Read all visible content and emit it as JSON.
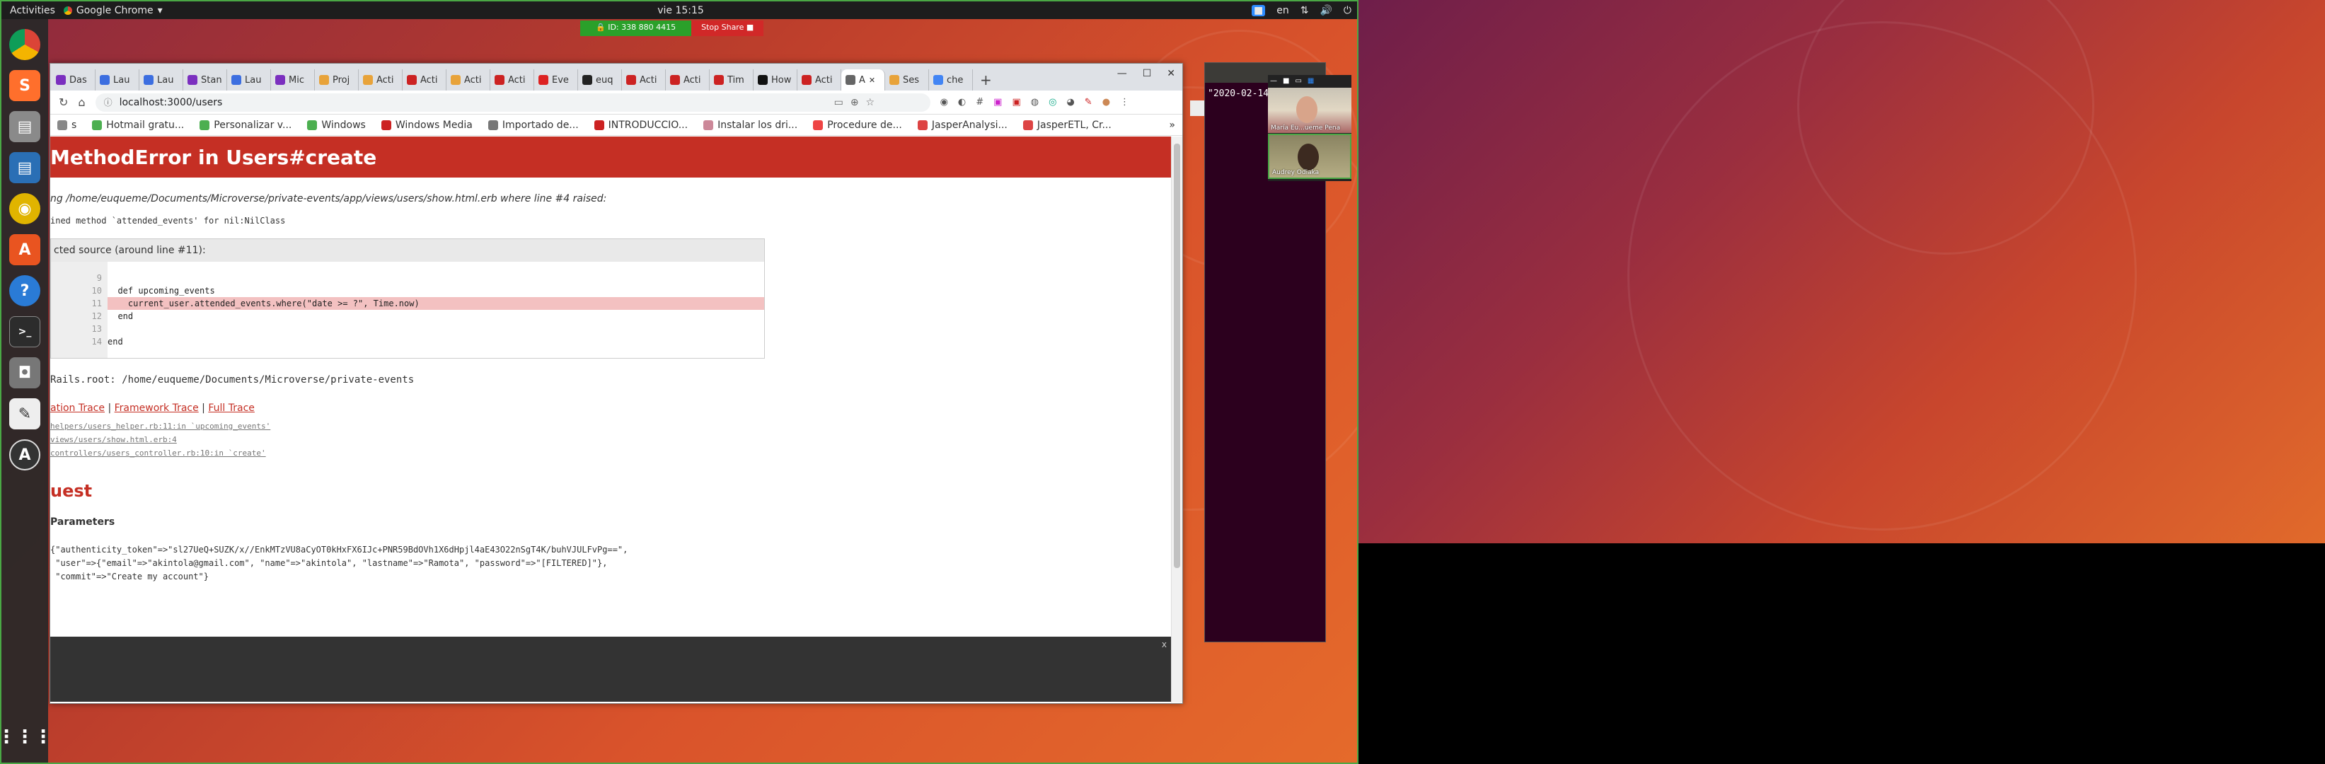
{
  "topbar": {
    "activities": "Activities",
    "app_name": "Google Chrome",
    "clock": "vie 15:15",
    "lang": "en"
  },
  "share": {
    "id_label": "ID: 338 880 4415",
    "stop_label": "Stop Share"
  },
  "browser": {
    "tabs": [
      {
        "label": "Das",
        "color": "#7b2fbf"
      },
      {
        "label": "Lau",
        "color": "#3c6ee0"
      },
      {
        "label": "Lau",
        "color": "#3c6ee0"
      },
      {
        "label": "Stan",
        "color": "#7b2fbf"
      },
      {
        "label": "Lau",
        "color": "#3c6ee0"
      },
      {
        "label": "Mic",
        "color": "#7b2fbf"
      },
      {
        "label": "Proj",
        "color": "#e8a33a"
      },
      {
        "label": "Acti",
        "color": "#e8a33a"
      },
      {
        "label": "Acti",
        "color": "#c22"
      },
      {
        "label": "Acti",
        "color": "#e8a33a"
      },
      {
        "label": "Acti",
        "color": "#c22"
      },
      {
        "label": "Eve",
        "color": "#d22"
      },
      {
        "label": "euq",
        "color": "#222"
      },
      {
        "label": "Acti",
        "color": "#c22"
      },
      {
        "label": "Acti",
        "color": "#c22"
      },
      {
        "label": "Tim",
        "color": "#c22"
      },
      {
        "label": "How",
        "color": "#111"
      },
      {
        "label": "Acti",
        "color": "#c22"
      },
      {
        "label": "A",
        "color": "#666"
      },
      {
        "label": "Ses",
        "color": "#e8a33a"
      },
      {
        "label": "che",
        "color": "#4285f4"
      }
    ],
    "url": "localhost:3000/users",
    "bookmarks": [
      {
        "label": "s",
        "color": "#888"
      },
      {
        "label": "Hotmail gratu...",
        "color": "#4caf50"
      },
      {
        "label": "Personalizar v...",
        "color": "#4caf50"
      },
      {
        "label": "Windows",
        "color": "#4caf50"
      },
      {
        "label": "Windows Media",
        "color": "#c22"
      },
      {
        "label": "Importado de...",
        "color": "#777"
      },
      {
        "label": "INTRODUCCIO...",
        "color": "#c22"
      },
      {
        "label": "Instalar los dri...",
        "color": "#c89"
      },
      {
        "label": "Procedure de...",
        "color": "#e44"
      },
      {
        "label": "JasperAnalysi...",
        "color": "#d44"
      },
      {
        "label": "JasperETL, Cr...",
        "color": "#d44"
      }
    ]
  },
  "error_page": {
    "title": "MethodError in Users#create",
    "raised_text": "ng /home/euqueme/Documents/Microverse/private-events/app/views/users/show.html.erb where line #4 raised:",
    "nomethod_text": "ined method `attended_events' for nil:NilClass",
    "source_header": "cted source (around line #11):",
    "line_numbers": [
      "9",
      "10",
      "11",
      "12",
      "13",
      "14"
    ],
    "source_lines": [
      "",
      "  def upcoming_events",
      "    current_user.attended_events.where(\"date >= ?\", Time.now)",
      "  end",
      "",
      "end"
    ],
    "rails_root": "Rails.root: /home/euqueme/Documents/Microverse/private-events",
    "trace_links": [
      "ation Trace",
      "Framework Trace",
      "Full Trace"
    ],
    "trace_items": [
      "helpers/users_helper.rb:11:in `upcoming_events'",
      "views/users/show.html.erb:4",
      "controllers/users_controller.rb:10:in `create'"
    ],
    "request_header": "uest",
    "params_header": "Parameters",
    "params_text": "{\"authenticity_token\"=>\"sl27UeQ+SUZK/x//EnkMTzVU8aCyOT0kHxFX6IJc+PNR59BdOVh1X6dHpjl4aE43O22nSgT4K/buhVJULFvPg==\",\n \"user\"=>{\"email\"=>\"akintola@gmail.com\", \"name\"=>\"akintola\", \"lastname\"=>\"Ramota\", \"password\"=>\"[FILTERED]\"},\n \"commit\"=>\"Create my account\"}",
    "console_close": "x"
  },
  "terminal": {
    "text": "\"2020-02-14 16:5"
  },
  "video": {
    "participant1": "María Eu...ueme Pena",
    "participant2": "Audrey Odiaka"
  },
  "colors": {
    "error_red": "#c52f24",
    "share_green": "#2aa02a",
    "share_red": "#d12828"
  }
}
